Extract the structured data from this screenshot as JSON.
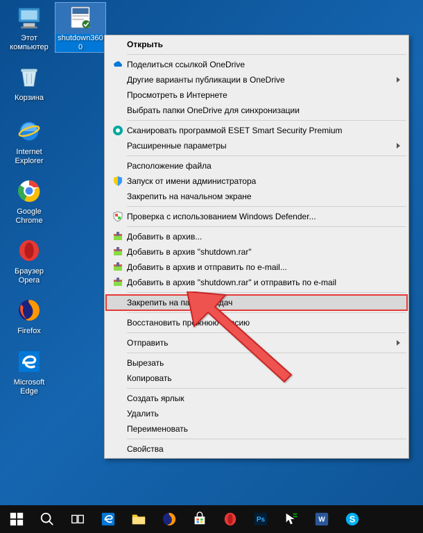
{
  "desktop_icons": [
    {
      "name": "this-pc",
      "label": "Этот\nкомпьютер"
    },
    {
      "name": "shutdown3600",
      "label": "shutdown360\n0",
      "selected": true
    },
    {
      "name": "recycle-bin",
      "label": "Корзина"
    },
    {
      "name": "internet-explorer",
      "label": "Internet\nExplorer"
    },
    {
      "name": "google-chrome",
      "label": "Google\nChrome"
    },
    {
      "name": "opera",
      "label": "Браузер\nOpera"
    },
    {
      "name": "firefox",
      "label": "Firefox"
    },
    {
      "name": "microsoft-edge",
      "label": "Microsoft\nEdge"
    }
  ],
  "context_menu": {
    "open": "Открыть",
    "onedrive_share": "Поделиться ссылкой OneDrive",
    "onedrive_other": "Другие варианты публикации в OneDrive",
    "view_online": "Просмотреть в Интернете",
    "choose_folders": "Выбрать папки OneDrive для синхронизации",
    "eset_scan": "Сканировать программой ESET Smart Security Premium",
    "eset_advanced": "Расширенные параметры",
    "file_location": "Расположение файла",
    "run_admin": "Запуск от имени администратора",
    "pin_start": "Закрепить на начальном экране",
    "defender": "Проверка с использованием Windows Defender...",
    "rar_add": "Добавить в архив...",
    "rar_add_named": "Добавить в архив \"shutdown.rar\"",
    "rar_email": "Добавить в архив и отправить по e-mail...",
    "rar_email_named": "Добавить в архив \"shutdown.rar\" и отправить по e-mail",
    "pin_taskbar": "Закрепить на панели задач",
    "restore_prev": "Восстановить прежнюю версию",
    "send_to": "Отправить",
    "cut": "Вырезать",
    "copy": "Копировать",
    "create_shortcut": "Создать ярлык",
    "delete": "Удалить",
    "rename": "Переименовать",
    "properties": "Свойства"
  },
  "taskbar": [
    "start",
    "search",
    "task-view",
    "edge",
    "file-explorer",
    "firefox",
    "store",
    "opera",
    "photoshop",
    "mouse-tool",
    "word",
    "skype"
  ]
}
